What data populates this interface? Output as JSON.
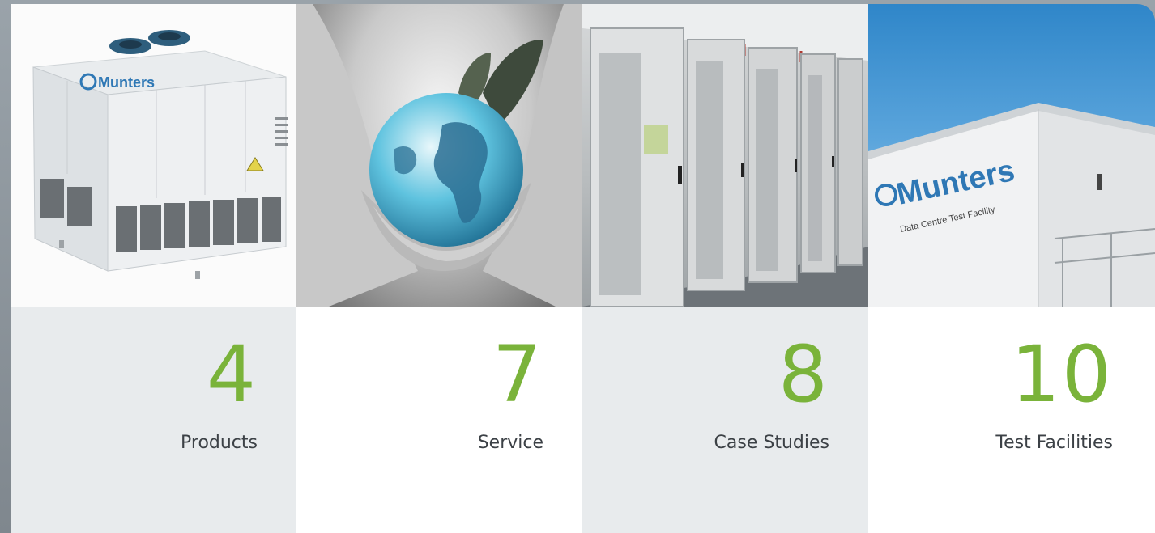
{
  "accent_color": "#7ab33a",
  "tiles": [
    {
      "number": "4",
      "label": "Products",
      "image": "air-handling-unit-photo"
    },
    {
      "number": "7",
      "label": "Service",
      "image": "hands-holding-globe-photo"
    },
    {
      "number": "8",
      "label": "Case Studies",
      "image": "server-racks-photo"
    },
    {
      "number": "10",
      "label": "Test Facilities",
      "image": "test-facility-building-photo"
    }
  ],
  "brand": {
    "unit_logo": "Munters",
    "building_logo": "Munters",
    "building_caption": "Data Centre Test Facility"
  }
}
